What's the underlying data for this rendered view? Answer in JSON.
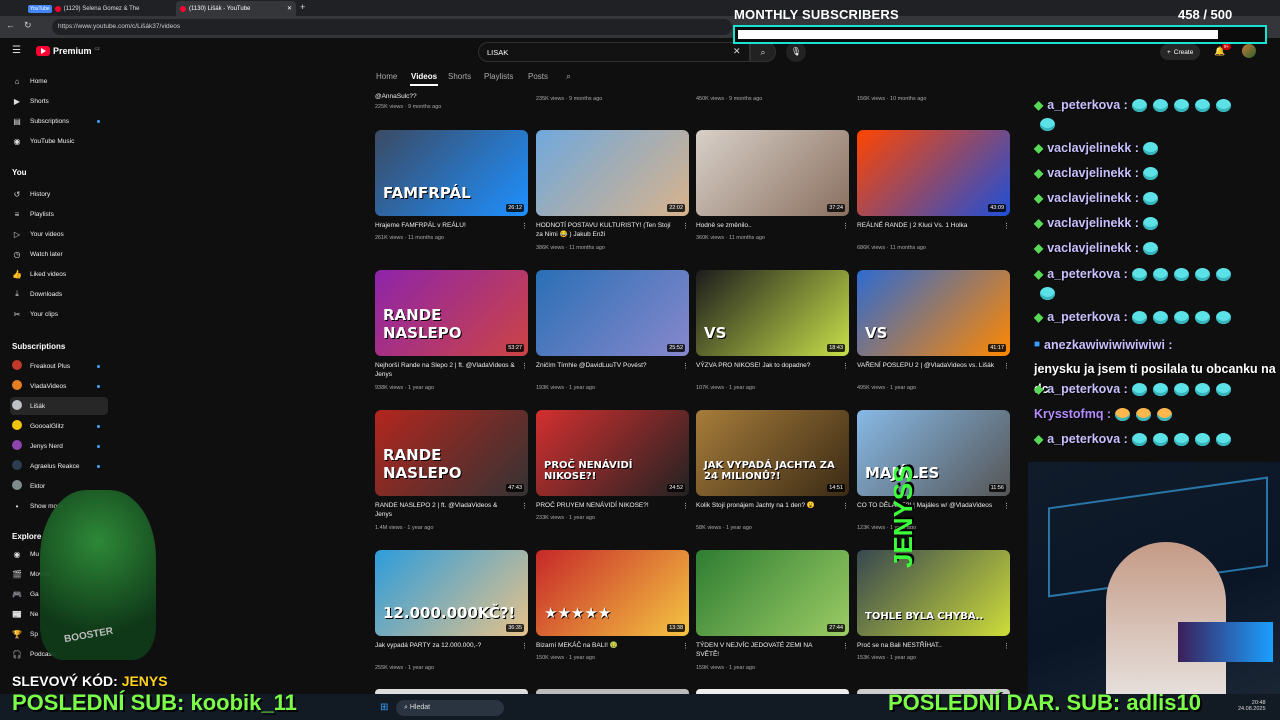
{
  "browser": {
    "tabs": [
      {
        "badge": "YouTube",
        "label": "(1129) Selena Gomez & The"
      },
      {
        "label": "(1130) Lišák - YouTube"
      }
    ],
    "url": "https://www.youtube.com/c/Lišák37/videos"
  },
  "youtube": {
    "logo": "Premium",
    "logo_sup": "CZ",
    "search_value": "LISAK",
    "create_label": "Create",
    "notif_count": "9+",
    "channel_tabs": [
      "Home",
      "Videos",
      "Shorts",
      "Playlists",
      "Posts"
    ],
    "sidebar": {
      "main": [
        {
          "label": "Home",
          "icon": "home-icon"
        },
        {
          "label": "Shorts",
          "icon": "shorts-icon"
        },
        {
          "label": "Subscriptions",
          "icon": "subscriptions-icon"
        },
        {
          "label": "YouTube Music",
          "icon": "music-icon"
        }
      ],
      "you_heading": "You",
      "you": [
        {
          "label": "History",
          "icon": "history-icon"
        },
        {
          "label": "Playlists",
          "icon": "playlists-icon"
        },
        {
          "label": "Your videos",
          "icon": "your-videos-icon"
        },
        {
          "label": "Watch later",
          "icon": "watch-later-icon"
        },
        {
          "label": "Liked videos",
          "icon": "liked-icon"
        },
        {
          "label": "Downloads",
          "icon": "download-icon"
        },
        {
          "label": "Your clips",
          "icon": "clips-icon"
        }
      ],
      "subs_heading": "Subscriptions",
      "subs": [
        {
          "label": "Freakout Plus",
          "color": "#c0392b"
        },
        {
          "label": "VladaVideos",
          "color": "#e67e22"
        },
        {
          "label": "Lišák",
          "color": "#bdc3c7"
        },
        {
          "label": "GoooalGlitz",
          "color": "#f1c40f"
        },
        {
          "label": "Jenys Nerd",
          "color": "#8e44ad"
        },
        {
          "label": "Agraelus Reakce",
          "color": "#2c3e50"
        },
        {
          "label": "Ektor",
          "color": "#7f8c8d"
        }
      ],
      "show_more": "Show more",
      "explore_heading": "Explore",
      "explore": [
        {
          "label": "Mu",
          "icon": "music-icon"
        },
        {
          "label": "Movies",
          "icon": "movies-icon"
        },
        {
          "label": "Ga",
          "icon": "gaming-icon"
        },
        {
          "label": "Ne",
          "icon": "news-icon"
        },
        {
          "label": "Sp",
          "icon": "sports-icon"
        },
        {
          "label": "Podcasts",
          "icon": "podcast-icon"
        }
      ]
    },
    "top_row_meta": [
      {
        "title": "@AnnaSulc??",
        "meta": "225K views · 9 months ago"
      },
      {
        "meta": "235K views · 9 months ago"
      },
      {
        "meta": "450K views · 9 months ago"
      },
      {
        "meta": "156K views · 10 months ago"
      }
    ],
    "videos": [
      {
        "title": "Hrajeme FAMFRPÁL v REÁLU!",
        "meta": "261K views · 11 months ago",
        "duration": "26:12",
        "thumb_text": "FAMFRPÁL",
        "colors": [
          "#3b4a63",
          "#1e90ff"
        ]
      },
      {
        "title": "HODNOTÍ POSTAVU KULTURISTY! (Ten Stojí za Nimi 😂 ) Jakub Enži",
        "meta": "386K views · 11 months ago",
        "duration": "22:02",
        "thumb_text": "",
        "colors": [
          "#6fa8dc",
          "#d9b38c"
        ]
      },
      {
        "title": "Hodně se změnilo..",
        "meta": "360K views · 11 months ago",
        "duration": "37:24",
        "thumb_text": "",
        "colors": [
          "#d8d0c8",
          "#8a7060"
        ]
      },
      {
        "title": "REÁLNÉ RANDE | 2 Kluci Vs. 1 Holka",
        "meta": "686K views · 11 months ago",
        "duration": "43:09",
        "thumb_text": "",
        "colors": [
          "#ff4500",
          "#1e4fd8"
        ]
      },
      {
        "title": "Nejhorší Rande na Slepo 2 | ft. @VladaVideos & Jenys",
        "meta": "938K views · 1 year ago",
        "duration": "53:27",
        "thumb_text": "RANDE NASLEPO",
        "colors": [
          "#8e24aa",
          "#c44"
        ]
      },
      {
        "title": "Zničím Tímhle @DavidLuuTV Povést?",
        "meta": "193K views · 1 year ago",
        "duration": "25:52",
        "thumb_text": "",
        "colors": [
          "#2a6fb5",
          "#88c"
        ]
      },
      {
        "title": "VÝZVA PRO NIKOSE! Jak to dopadne?",
        "meta": "107K views · 1 year ago",
        "duration": "18:43",
        "thumb_text": "VS",
        "colors": [
          "#1c1c1c",
          "#c8e04a"
        ]
      },
      {
        "title": "VAŘENÍ POSLEPU 2 | @VladaVideos vs. Lišák",
        "meta": "495K views · 1 year ago",
        "duration": "41:17",
        "thumb_text": "VS",
        "colors": [
          "#2e6ad0",
          "#ff8800"
        ]
      },
      {
        "title": "RANDE NASLEPO 2 | ft. @VladaVideos & Jenys",
        "meta": "1.4M views · 1 year ago",
        "duration": "47:43",
        "thumb_text": "RANDE NASLEPO",
        "colors": [
          "#b3261e",
          "#333"
        ]
      },
      {
        "title": "PROČ PRUYEM NENÁVIDÍ NIKOSE?!",
        "meta": "233K views · 1 year ago",
        "duration": "24:52",
        "thumb_text": "PROČ NENÁVIDÍ NIKOSE?!",
        "colors": [
          "#d32f2f",
          "#222"
        ]
      },
      {
        "title": "Kolik Stojí pronájem Jachty na 1 den? 😮",
        "meta": "58K views · 1 year ago",
        "duration": "14:51",
        "thumb_text": "JAK VYPADÁ JACHTA ZA 24 MILIONŮ?!",
        "colors": [
          "#a67c3a",
          "#3a2a15"
        ]
      },
      {
        "title": "CO TO DĚLÁME?! | Majáles w/ @VladaVideos",
        "meta": "123K views · 1 year ago",
        "duration": "11:56",
        "thumb_text": "MAJÁLES",
        "colors": [
          "#87b9e6",
          "#555"
        ]
      },
      {
        "title": "Jak vypadá PARTY za 12.000.000,-?",
        "meta": "255K views · 1 year ago",
        "duration": "36:35",
        "thumb_text": "12.000.000KČ?!",
        "colors": [
          "#2d9cdb",
          "#e6c28a"
        ]
      },
      {
        "title": "Bizarní MEKÁČ na BALI! 🤢",
        "meta": "150K views · 1 year ago",
        "duration": "13:38",
        "thumb_text": "★★★★★",
        "colors": [
          "#c62828",
          "#f5c542"
        ]
      },
      {
        "title": "TÝDEN V NEJVÍC JEDOVATÉ ZEMI NA SVĚTĚ!",
        "meta": "159K views · 1 year ago",
        "duration": "27:44",
        "thumb_text": "",
        "colors": [
          "#2e7d32",
          "#9ccc65"
        ]
      },
      {
        "title": "Proč se na Bali NESTŘÍHAT..",
        "meta": "153K views · 1 year ago",
        "duration": "",
        "thumb_text": "TOHLE BYLA CHYBA..",
        "colors": [
          "#37474f",
          "#cddc39"
        ]
      }
    ]
  },
  "overlay": {
    "sub_title": "MONTHLY SUBSCRIBERS",
    "sub_count": "458",
    "sub_goal": "/ 500",
    "sub_progress": 0.916,
    "chat": [
      {
        "name": "a_peterkova :",
        "emotes": 6,
        "badge": "diamond"
      },
      {
        "name": "vaclavjelinekk :",
        "emotes": 1,
        "badge": "diamond"
      },
      {
        "name": "vaclavjelinekk :",
        "emotes": 1,
        "badge": "diamond"
      },
      {
        "name": "vaclavjelinekk :",
        "emotes": 1,
        "badge": "diamond"
      },
      {
        "name": "vaclavjelinekk :",
        "emotes": 1,
        "badge": "diamond"
      },
      {
        "name": "vaclavjelinekk :",
        "emotes": 1,
        "badge": "diamond"
      },
      {
        "name": "a_peterkova :",
        "emotes": 6,
        "badge": "diamond"
      },
      {
        "name": "a_peterkova :",
        "emotes": 5,
        "badge": "diamond"
      },
      {
        "name": "anezkawiwiwiwiwiwi :",
        "text": "jenysku ja jsem ti posilala tu obcanku na dc",
        "badge": "cube"
      },
      {
        "name": "a_peterkova :",
        "emotes": 5,
        "badge": "diamond"
      },
      {
        "name": "Krysstofmq :",
        "emotes": 3,
        "badge": "none",
        "emote_color": "#ffb74d"
      },
      {
        "name": "a_peterkova :",
        "emotes": 5,
        "badge": "diamond"
      }
    ],
    "promo_prefix": "SLEVOVÝ KÓD:",
    "promo_code": "JENYS",
    "last_sub": "POSLEDNÍ SUB: koobik_11",
    "last_dar": "POSLEDNÍ DAR. SUB: adlis10",
    "jenys_vertical": "JENYSS",
    "booster_label": "BOOSTER"
  },
  "taskbar": {
    "search_placeholder": "Hledat",
    "time": "20:48",
    "date": "24.08.2025"
  }
}
